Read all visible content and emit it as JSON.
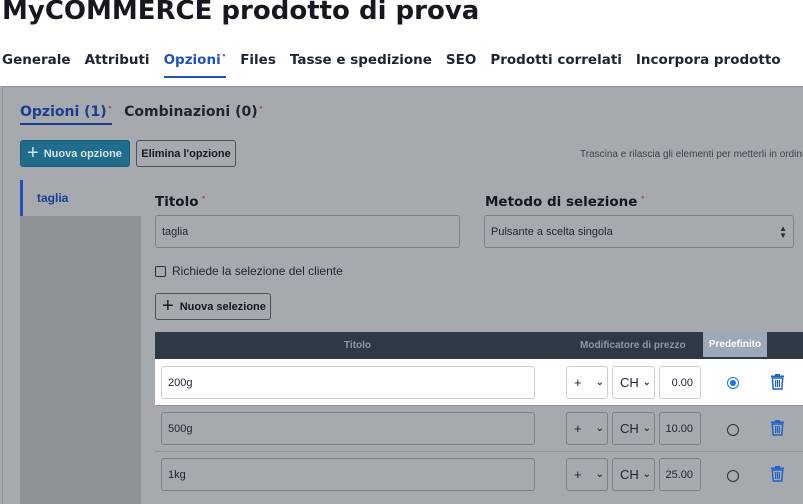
{
  "page": {
    "title": "MyCOMMERCE prodotto di prova"
  },
  "main_tabs": [
    {
      "label": "Generale",
      "marker": ""
    },
    {
      "label": "Attributi",
      "marker": ""
    },
    {
      "label": "Opzioni",
      "marker": "•"
    },
    {
      "label": "Files",
      "marker": ""
    },
    {
      "label": "Tasse e spedizione",
      "marker": ""
    },
    {
      "label": "SEO",
      "marker": ""
    },
    {
      "label": "Prodotti correlati",
      "marker": ""
    },
    {
      "label": "Incorpora prodotto",
      "marker": ""
    }
  ],
  "sub_tabs": [
    {
      "label": "Opzioni (1)",
      "marker": "•"
    },
    {
      "label": "Combinazioni (0)",
      "marker": "•"
    }
  ],
  "toolbar": {
    "new_option_label": "Nuova opzione",
    "delete_option_label": "Elimina l'opzione",
    "drag_hint": "Trascina e rilascia gli elementi per metterli in ordine"
  },
  "options_list": [
    {
      "label": "taglia"
    }
  ],
  "option_form": {
    "title_label": "Titolo",
    "title_required": "•",
    "title_value": "taglia",
    "method_label": "Metodo di selezione",
    "method_required": "•",
    "method_value": "Pulsante a scelta singola",
    "require_selection_label": "Richiede la selezione del cliente",
    "new_selection_label": "Nuova selezione"
  },
  "selections_table": {
    "headers": {
      "title": "Titolo",
      "price_modifier": "Modificatore di prezzo",
      "default": "Predefinito"
    },
    "rows": [
      {
        "title": "200g",
        "sign": "+",
        "currency": "CH",
        "price": "0.00",
        "default": true
      },
      {
        "title": "500g",
        "sign": "+",
        "currency": "CH",
        "price": "10.00",
        "default": false
      },
      {
        "title": "1kg",
        "sign": "+",
        "currency": "CH",
        "price": "25.00",
        "default": false
      }
    ]
  },
  "colors": {
    "accent": "#1f53b5",
    "table_header": "#2f3944",
    "overlay_gray": "#a6aaae",
    "radio_selected": "#1a73e8",
    "trash_icon": "#1f63c8"
  }
}
